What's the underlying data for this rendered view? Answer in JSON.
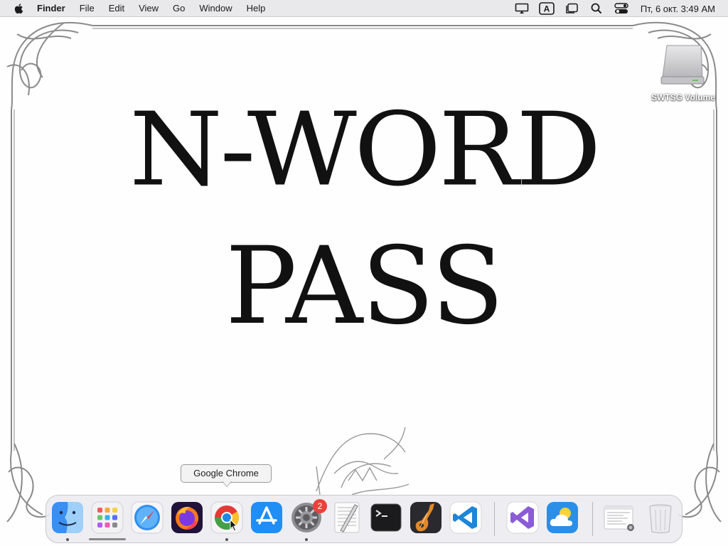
{
  "menubar": {
    "app_name": "Finder",
    "menus": [
      "File",
      "Edit",
      "View",
      "Go",
      "Window",
      "Help"
    ],
    "input_source": "A",
    "clock": "Пт, 6 окт.  3:49 AM",
    "status_icons": [
      "display-icon",
      "input-source-icon",
      "stage-manager-icon",
      "spotlight-icon",
      "control-center-icon"
    ]
  },
  "wallpaper": {
    "title_line1": "N-WORD",
    "title_line2": "PASS"
  },
  "desktop": {
    "drive_label": "SWTSG Volume"
  },
  "tooltip": {
    "text": "Google Chrome"
  },
  "dock": {
    "items": [
      {
        "name": "Finder",
        "icon": "finder-icon",
        "running": true
      },
      {
        "name": "Launchpad",
        "icon": "launchpad-icon",
        "running": false
      },
      {
        "name": "Safari",
        "icon": "safari-icon",
        "running": false
      },
      {
        "name": "Firefox",
        "icon": "firefox-icon",
        "running": false
      },
      {
        "name": "Google Chrome",
        "icon": "chrome-icon",
        "running": true
      },
      {
        "name": "App Store",
        "icon": "app-store-icon",
        "running": false
      },
      {
        "name": "System Settings",
        "icon": "system-settings-icon",
        "running": true,
        "badge": "2"
      },
      {
        "name": "TextEdit",
        "icon": "textedit-icon",
        "running": false
      },
      {
        "name": "Terminal",
        "icon": "terminal-icon",
        "running": false
      },
      {
        "name": "GarageBand",
        "icon": "garageband-icon",
        "running": false
      },
      {
        "name": "Visual Studio Code",
        "icon": "vscode-icon",
        "running": false
      },
      {
        "name": "Visual Studio",
        "icon": "visual-studio-icon",
        "running": false
      },
      {
        "name": "Weather",
        "icon": "weather-icon",
        "running": false
      },
      {
        "name": "Downloads",
        "icon": "downloads-stack-icon",
        "running": false
      },
      {
        "name": "Trash",
        "icon": "trash-icon",
        "running": false
      }
    ]
  },
  "colors": {
    "menubar_bg": "#e9e9ec",
    "badge": "#e8433a"
  }
}
